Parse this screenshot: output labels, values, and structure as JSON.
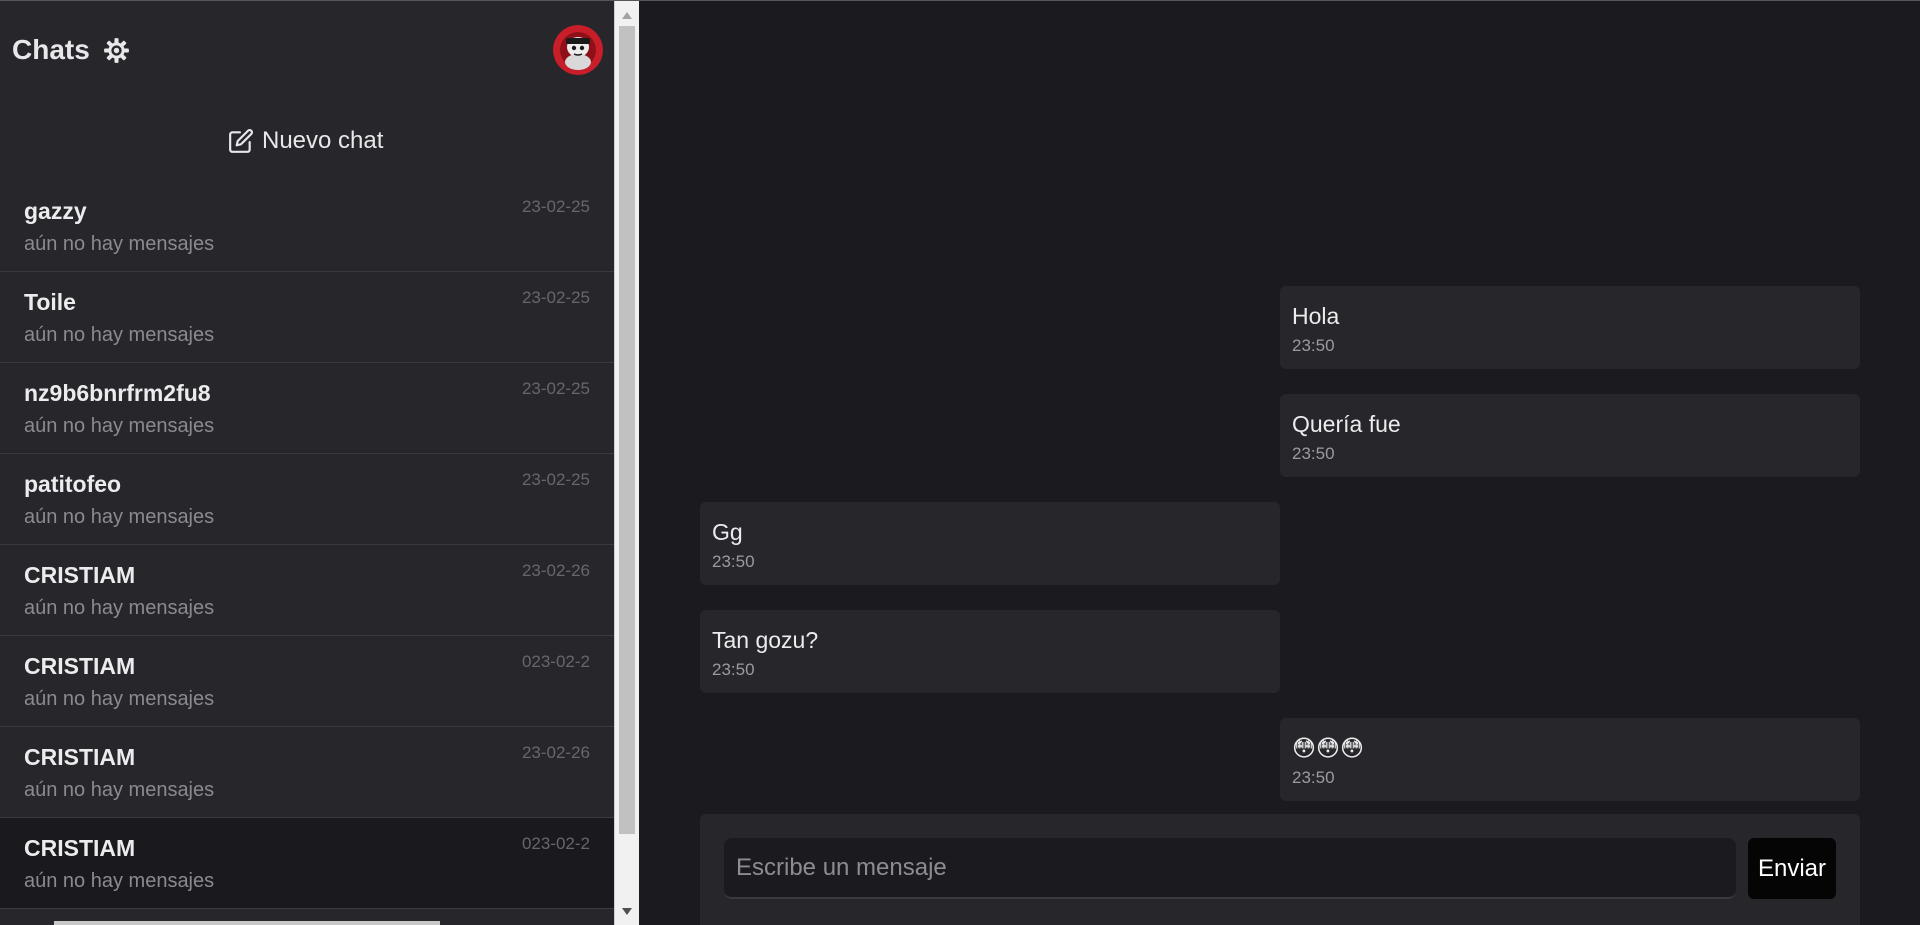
{
  "sidebar": {
    "title": "Chats",
    "settings_icon": "gear-icon",
    "avatar_icon": "user-avatar-image",
    "new_chat_label": "Nuevo chat",
    "new_chat_icon": "edit-square-icon",
    "chats": [
      {
        "name": "gazzy",
        "preview": "aún no hay mensajes",
        "date": "23-02-25"
      },
      {
        "name": "Toile",
        "preview": "aún no hay mensajes",
        "date": "23-02-25"
      },
      {
        "name": "nz9b6bnrfrm2fu8",
        "preview": "aún no hay mensajes",
        "date": "23-02-25"
      },
      {
        "name": "patitofeo",
        "preview": "aún no hay mensajes",
        "date": "23-02-25"
      },
      {
        "name": "CRISTIAM",
        "preview": "aún no hay mensajes",
        "date": "23-02-26"
      },
      {
        "name": "CRISTIAM",
        "preview": "aún no hay mensajes",
        "date": "023-02-2"
      },
      {
        "name": "CRISTIAM",
        "preview": "aún no hay mensajes",
        "date": "23-02-26"
      },
      {
        "name": "CRISTIAM",
        "preview": "aún no hay mensajes",
        "date": "023-02-2"
      }
    ]
  },
  "conversation": {
    "messages": [
      {
        "text": "Hola",
        "time": "23:50",
        "side": "mine"
      },
      {
        "text": "Quería fue",
        "time": "23:50",
        "side": "mine"
      },
      {
        "text": "Gg",
        "time": "23:50",
        "side": "theirs"
      },
      {
        "text": "Tan gozu?",
        "time": "23:50",
        "side": "theirs"
      },
      {
        "text": "😳😳😳",
        "time": "23:50",
        "side": "mine"
      }
    ],
    "input_placeholder": "Escribe un mensaje",
    "send_label": "Enviar"
  },
  "colors": {
    "sidebar_bg": "#27262b",
    "main_bg": "#1b1a1f",
    "bubble_bg": "#27262b",
    "send_button_bg": "#050506",
    "avatar_red": "#c81e2a"
  }
}
